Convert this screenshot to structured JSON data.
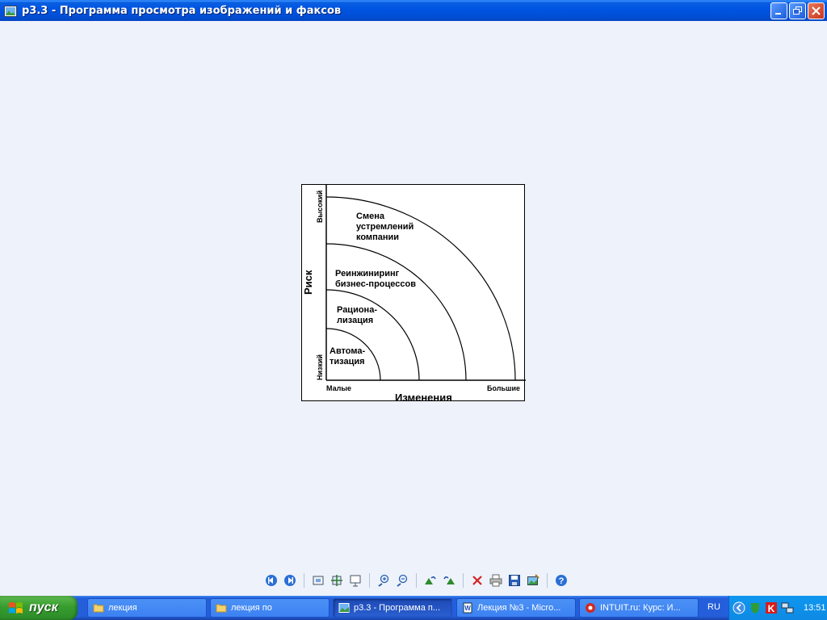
{
  "window": {
    "title": "р3.3 - Программа просмотра изображений и факсов"
  },
  "image": {
    "zones": [
      "Автома-\nтизация",
      "Рациона-\nлизация",
      "Реинжиниринг\nбизнес-процессов",
      "Смена\nустремлений\nкомпании"
    ],
    "y_axis_label": "Риск",
    "y_low": "Низкий",
    "y_high": "Высокий",
    "x_axis_label": "Изменения",
    "x_low": "Малые",
    "x_high": "Большие"
  },
  "toolbar": {
    "buttons": [
      "previous-image",
      "next-image",
      "best-fit",
      "actual-size",
      "slideshow",
      "zoom-in",
      "zoom-out",
      "rotate-clockwise",
      "rotate-counterclockwise",
      "delete",
      "print",
      "copy-to",
      "open-for-editing",
      "help"
    ]
  },
  "taskbar": {
    "start_label": "пуск",
    "tasks": [
      {
        "label": "лекция"
      },
      {
        "label": "лекция по"
      },
      {
        "label": "р3.3 - Программа п..."
      },
      {
        "label": "Лекция №3 - Micro..."
      },
      {
        "label": "INTUIT.ru: Курс: И..."
      }
    ],
    "language": "RU",
    "clock": "13:51"
  },
  "colors": {
    "titlebar": "#0054e3",
    "viewer_bg": "#eef2fb",
    "taskbar": "#245edb",
    "start": "#379d2f"
  }
}
